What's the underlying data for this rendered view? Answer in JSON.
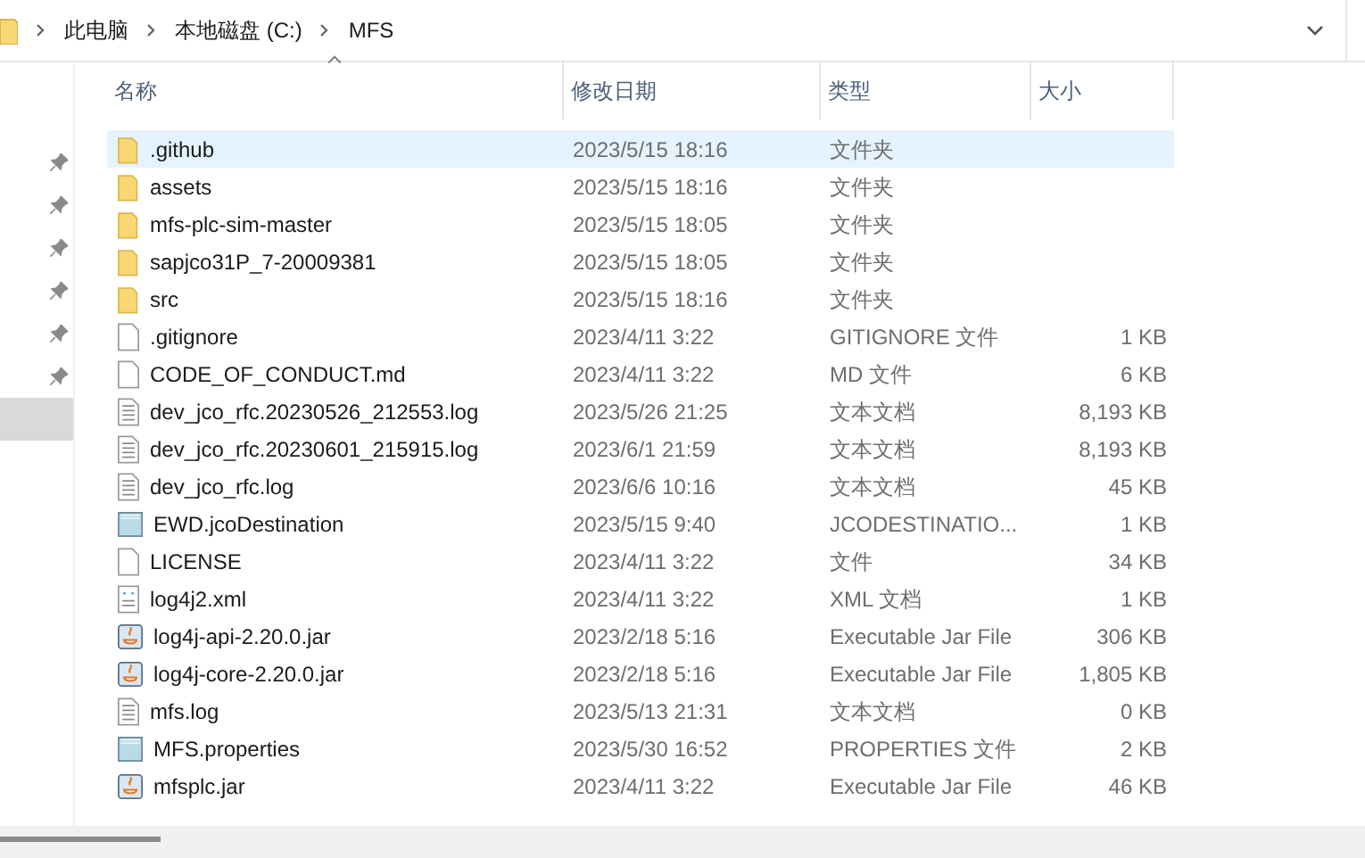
{
  "breadcrumb": [
    "此电脑",
    "本地磁盘 (C:)",
    "MFS"
  ],
  "columns": [
    "名称",
    "修改日期",
    "类型",
    "大小"
  ],
  "nav_pins": [
    {
      "selected": false
    },
    {
      "selected": false
    },
    {
      "selected": false
    },
    {
      "selected": false
    },
    {
      "selected": false
    },
    {
      "selected": false
    },
    {
      "selected": true
    }
  ],
  "files": [
    {
      "kind": "folder",
      "name": ".github",
      "modified": "2023/5/15 18:16",
      "type": "文件夹",
      "selected": true
    },
    {
      "kind": "folder",
      "name": "assets",
      "modified": "2023/5/15 18:16",
      "type": "文件夹",
      "selected": false
    },
    {
      "kind": "folder",
      "name": "mfs-plc-sim-master",
      "modified": "2023/5/15 18:05",
      "type": "文件夹",
      "selected": false
    },
    {
      "kind": "folder",
      "name": "sapjco31P_7-20009381",
      "modified": "2023/5/15 18:05",
      "type": "文件夹",
      "selected": false
    },
    {
      "kind": "folder",
      "name": "src",
      "modified": "2023/5/15 18:16",
      "type": "文件夹",
      "selected": false
    },
    {
      "kind": "blank",
      "name": ".gitignore",
      "modified": "2023/4/11 3:22",
      "type": "GITIGNORE 文件",
      "size": "1 KB",
      "selected": false
    },
    {
      "kind": "blank",
      "name": "CODE_OF_CONDUCT.md",
      "modified": "2023/4/11 3:22",
      "type": "MD 文件",
      "size": "6 KB",
      "selected": false
    },
    {
      "kind": "text",
      "name": "dev_jco_rfc.20230526_212553.log",
      "modified": "2023/5/26 21:25",
      "type": "文本文档",
      "size": "8,193 KB",
      "selected": false
    },
    {
      "kind": "text",
      "name": "dev_jco_rfc.20230601_215915.log",
      "modified": "2023/6/1 21:59",
      "type": "文本文档",
      "size": "8,193 KB",
      "selected": false
    },
    {
      "kind": "text",
      "name": "dev_jco_rfc.log",
      "modified": "2023/6/6 10:16",
      "type": "文本文档",
      "size": "45 KB",
      "selected": false
    },
    {
      "kind": "config",
      "name": "EWD.jcoDestination",
      "modified": "2023/5/15 9:40",
      "type": "JCODESTINATIO...",
      "size": "1 KB",
      "selected": false
    },
    {
      "kind": "blank",
      "name": "LICENSE",
      "modified": "2023/4/11 3:22",
      "type": "文件",
      "size": "34 KB",
      "selected": false
    },
    {
      "kind": "xml",
      "name": "log4j2.xml",
      "modified": "2023/4/11 3:22",
      "type": "XML 文档",
      "size": "1 KB",
      "selected": false
    },
    {
      "kind": "jar",
      "name": "log4j-api-2.20.0.jar",
      "modified": "2023/2/18 5:16",
      "type": "Executable Jar File",
      "size": "306 KB",
      "selected": false
    },
    {
      "kind": "jar",
      "name": "log4j-core-2.20.0.jar",
      "modified": "2023/2/18 5:16",
      "type": "Executable Jar File",
      "size": "1,805 KB",
      "selected": false
    },
    {
      "kind": "text",
      "name": "mfs.log",
      "modified": "2023/5/13 21:31",
      "type": "文本文档",
      "size": "0 KB",
      "selected": false
    },
    {
      "kind": "config",
      "name": "MFS.properties",
      "modified": "2023/5/30 16:52",
      "type": "PROPERTIES 文件",
      "size": "2 KB",
      "selected": false
    },
    {
      "kind": "jar",
      "name": "mfsplc.jar",
      "modified": "2023/4/11 3:22",
      "type": "Executable Jar File",
      "size": "46 KB",
      "selected": false
    }
  ]
}
